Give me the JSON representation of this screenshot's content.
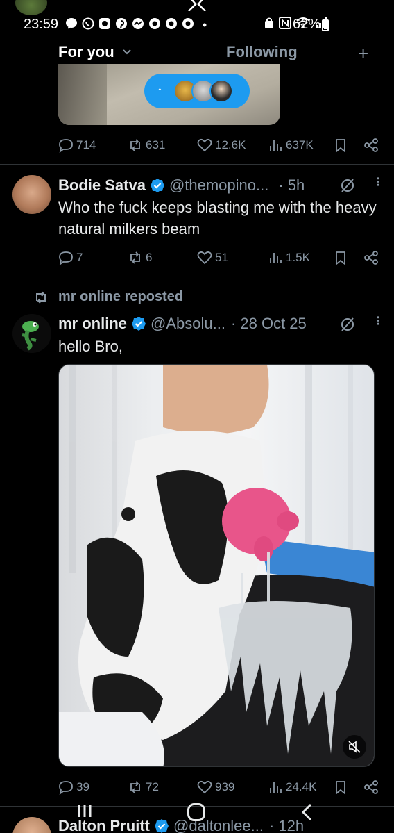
{
  "status_bar": {
    "time": "23:59",
    "battery": "62%",
    "notification_icons": [
      "messenger-icon",
      "whatsapp-icon",
      "signal-icon",
      "pinterest-icon",
      "messenger-icon",
      "c-app-icon",
      "c-app-icon",
      "c-app-icon",
      "dot-icon"
    ],
    "right_icons": [
      "alarm-icon",
      "nfc-icon",
      "wifi-icon",
      "signal-bars-icon",
      "battery-icon"
    ]
  },
  "header": {
    "tab_for_you": "For you",
    "tab_following": "Following",
    "plus_label": "+"
  },
  "new_posts_pill": {
    "arrow": "↑",
    "avatars": [
      "avatar-monkey",
      "avatar-grey",
      "avatar-hat"
    ]
  },
  "posts": [
    {
      "stats": {
        "replies": "714",
        "reposts": "631",
        "likes": "12.6K",
        "views": "637K"
      }
    },
    {
      "author": "Bodie Satva",
      "handle": "@themopino...",
      "time": "· 5h",
      "text": "Who the fuck keeps blasting me with the heavy natural milkers beam",
      "stats": {
        "replies": "7",
        "reposts": "6",
        "likes": "51",
        "views": "1.5K"
      }
    },
    {
      "repost_label": "mr online reposted",
      "author": "mr online",
      "handle": "@Absolu...",
      "time": "· 28 Oct 25",
      "text": "hello Bro,",
      "stats": {
        "replies": "39",
        "reposts": "72",
        "likes": "939",
        "views": "24.4K"
      }
    },
    {
      "author": "Dalton Pruitt",
      "handle": "@daltonlee...",
      "time": "· 12h"
    }
  ],
  "colors": {
    "background": "#000000",
    "accent": "#1d9bf0",
    "muted": "#8b98a5",
    "divider": "#2f3336"
  }
}
